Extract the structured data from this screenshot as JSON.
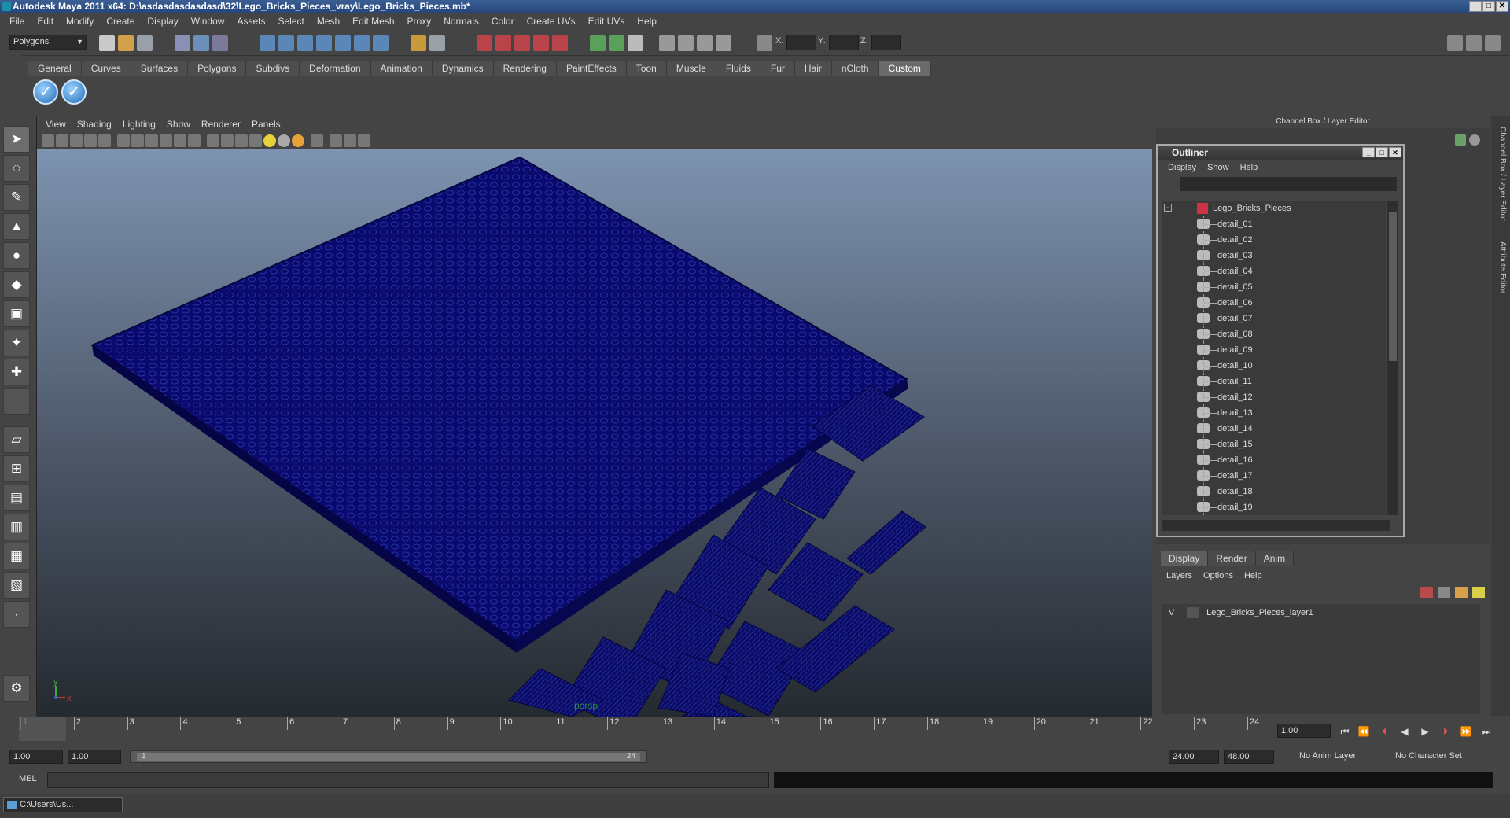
{
  "window": {
    "title": "Autodesk Maya 2011 x64: D:\\asdasdasdasdasd\\32\\Lego_Bricks_Pieces_vray\\Lego_Bricks_Pieces.mb*"
  },
  "menubar": [
    "File",
    "Edit",
    "Modify",
    "Create",
    "Display",
    "Window",
    "Assets",
    "Select",
    "Mesh",
    "Edit Mesh",
    "Proxy",
    "Normals",
    "Color",
    "Create UVs",
    "Edit UVs",
    "Help"
  ],
  "status": {
    "mode": "Polygons",
    "x_label": "X:",
    "y_label": "Y:",
    "z_label": "Z:"
  },
  "shelf": {
    "tabs": [
      "General",
      "Curves",
      "Surfaces",
      "Polygons",
      "Subdivs",
      "Deformation",
      "Animation",
      "Dynamics",
      "Rendering",
      "PaintEffects",
      "Toon",
      "Muscle",
      "Fluids",
      "Fur",
      "Hair",
      "nCloth",
      "Custom"
    ],
    "active": "Custom"
  },
  "viewport": {
    "menu": [
      "View",
      "Shading",
      "Lighting",
      "Show",
      "Renderer",
      "Panels"
    ],
    "camera": "persp",
    "axis_y": "y",
    "axis_x": "x",
    "accent": "#0a0a6e"
  },
  "channelbox": {
    "title": "Channel Box / Layer Editor"
  },
  "outliner": {
    "title": "Outliner",
    "menu": [
      "Display",
      "Show",
      "Help"
    ],
    "root": "Lego_Bricks_Pieces",
    "items": [
      "detail_01",
      "detail_02",
      "detail_03",
      "detail_04",
      "detail_05",
      "detail_06",
      "detail_07",
      "detail_08",
      "detail_09",
      "detail_10",
      "detail_11",
      "detail_12",
      "detail_13",
      "detail_14",
      "detail_15",
      "detail_16",
      "detail_17",
      "detail_18",
      "detail_19"
    ]
  },
  "layers": {
    "tabs": [
      "Display",
      "Render",
      "Anim"
    ],
    "menu": [
      "Layers",
      "Options",
      "Help"
    ],
    "row": {
      "visible": "V",
      "name": "Lego_Bricks_Pieces_layer1"
    }
  },
  "side_tabs": [
    "Channel Box / Layer Editor",
    "Attribute Editor"
  ],
  "timeline": {
    "ticks": [
      "1",
      "2",
      "3",
      "4",
      "5",
      "6",
      "7",
      "8",
      "9",
      "10",
      "11",
      "12",
      "13",
      "14",
      "15",
      "16",
      "17",
      "18",
      "19",
      "20",
      "21",
      "22",
      "23",
      "24"
    ],
    "current": "1.00"
  },
  "range": {
    "start": "1.00",
    "start2": "1.00",
    "bar_start": "1",
    "bar_end": "24",
    "end": "24.00",
    "end2": "48.00",
    "anim_layer": "No Anim Layer",
    "char_set": "No Character Set"
  },
  "command": {
    "label": "MEL"
  },
  "taskbar": {
    "item": "C:\\Users\\Us..."
  }
}
